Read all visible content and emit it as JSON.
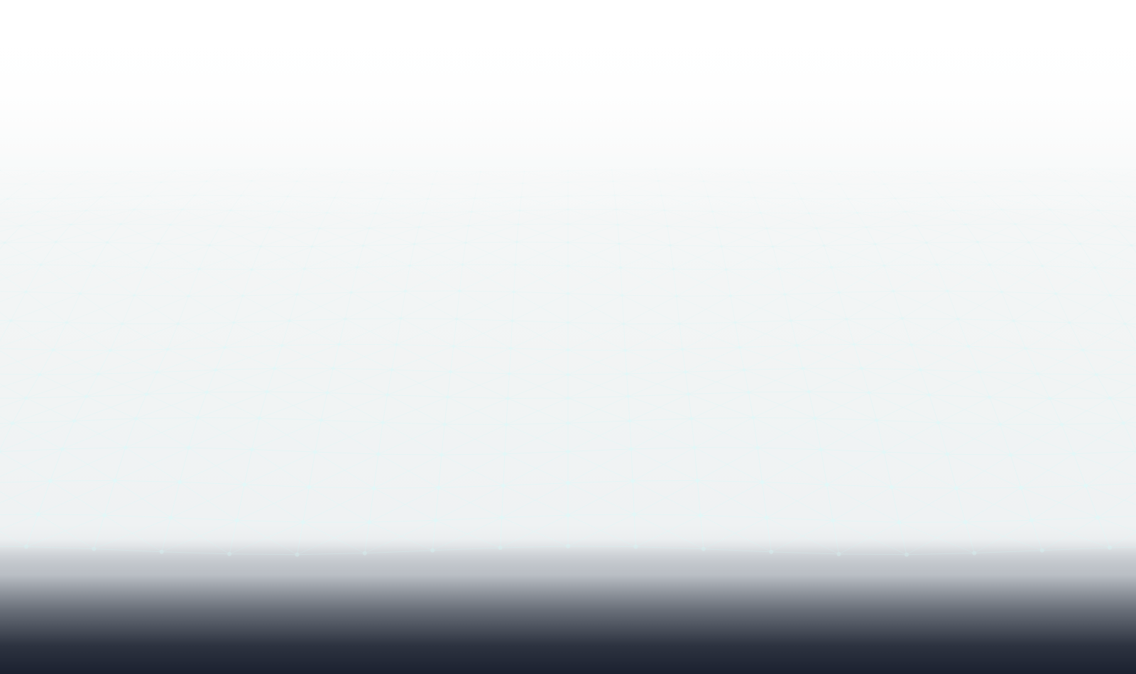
{
  "background": {
    "icon": "wireframe-grid-terrain",
    "accent_color": "#dff6f6",
    "top_color": "#ffffff",
    "mid_color": "#f1f4f4",
    "bottom_color": "#1b2130"
  }
}
